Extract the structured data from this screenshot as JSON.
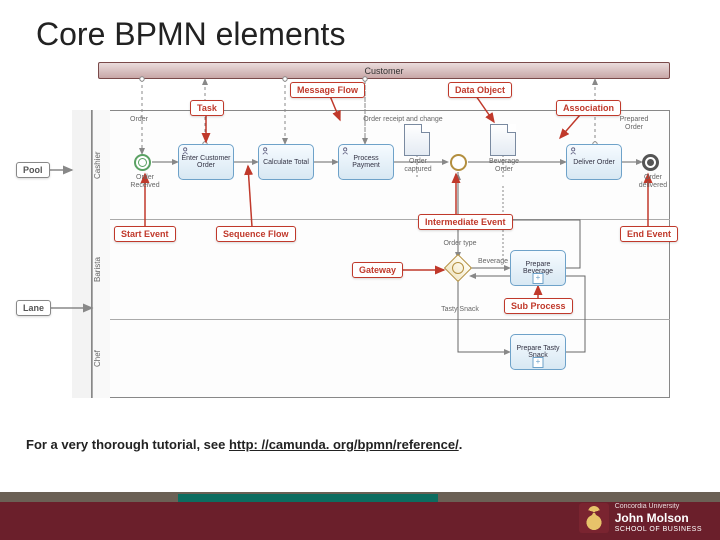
{
  "title": "Core BPMN elements",
  "footer": {
    "lead": "For a very thorough tutorial, see ",
    "link": "http: //camunda. org/bpmn/reference/",
    "tail": "."
  },
  "branding": {
    "university": "Concordia University",
    "brand": "John Molson",
    "school": "SCHOOL OF BUSINESS"
  },
  "participants": {
    "external": "Customer"
  },
  "lanes": {
    "first": "Cashier",
    "second": "Barista",
    "third": "Chef"
  },
  "callouts": {
    "pool": "Pool",
    "lane": "Lane",
    "task": "Task",
    "message_flow": "Message Flow",
    "data_object": "Data Object",
    "association": "Association",
    "start_event": "Start Event",
    "sequence_flow": "Sequence Flow",
    "intermediate_event": "Intermediate Event",
    "end_event": "End Event",
    "gateway": "Gateway",
    "sub_process": "Sub Process"
  },
  "tasks": {
    "enter_order": "Enter Customer Order",
    "calc_total": "Calculate Total",
    "process_payment": "Process Payment",
    "deliver_order": "Deliver Order",
    "prepare_beverage": "Prepare Beverage",
    "prepare_snack": "Prepare Tasty Snack"
  },
  "labels": {
    "order_received": "Order Received",
    "order_captured": "Order captured",
    "beverage_order": "Beverage Order",
    "prepared_order": "Prepared Order",
    "order_delivered": "Order delivered",
    "order_receipt": "Order receipt and change",
    "order": "Order",
    "order_type": "Order type",
    "beverage": "Beverage",
    "tasty_snack": "Tasty Snack"
  }
}
